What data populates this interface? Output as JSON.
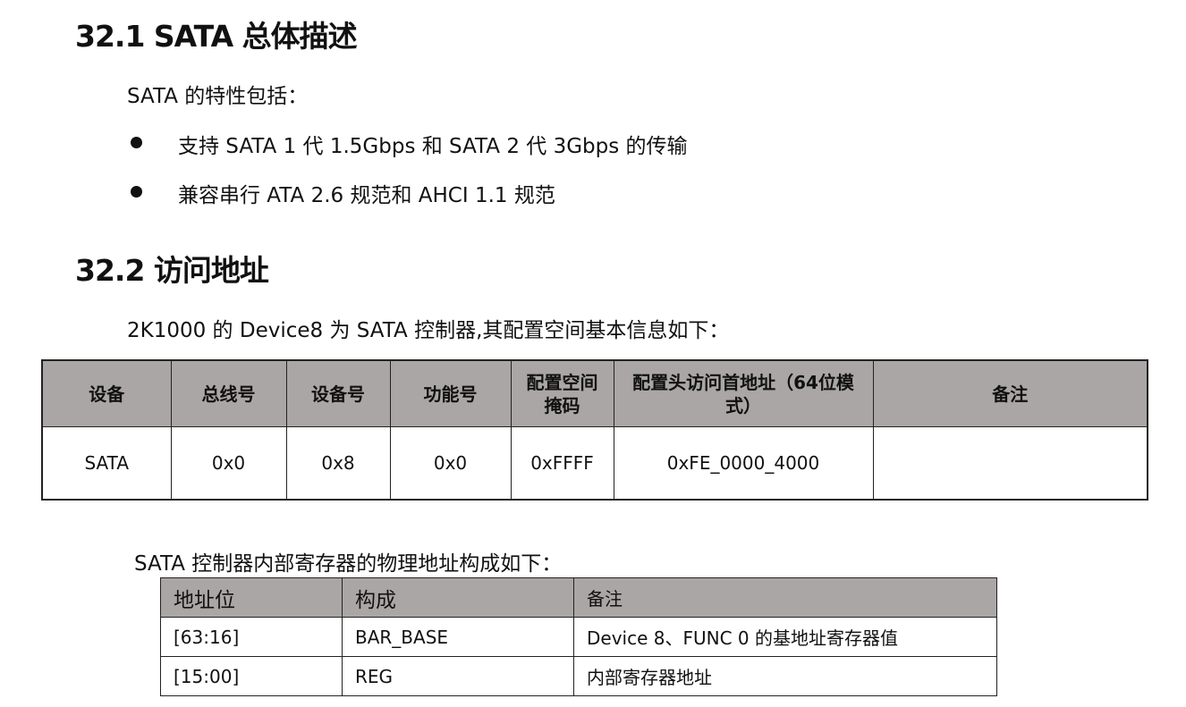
{
  "s1": {
    "title": "32.1 SATA 总体描述",
    "intro": "SATA 的特性包括：",
    "bullets": [
      "支持 SATA 1 代 1.5Gbps 和 SATA 2 代 3Gbps 的传输",
      "兼容串行 ATA 2.6 规范和 AHCI 1.1 规范"
    ]
  },
  "s2": {
    "title": "32.2 访问地址",
    "intro": "2K1000 的 Device8 为 SATA 控制器,其配置空间基本信息如下：",
    "table1": {
      "headers": [
        "设备",
        "总线号",
        "设备号",
        "功能号",
        "配置空间掩码",
        "配置头访问首地址（64位模式）",
        "备注"
      ],
      "row": [
        "SATA",
        "0x0",
        "0x8",
        "0x0",
        "0xFFFF",
        "0xFE_0000_4000",
        ""
      ]
    },
    "intro2": "SATA 控制器内部寄存器的物理地址构成如下：",
    "table2": {
      "headers": [
        "地址位",
        "构成",
        "备注"
      ],
      "rows": [
        [
          "[63:16]",
          "BAR_BASE",
          "Device 8、FUNC 0 的基地址寄存器值"
        ],
        [
          "[15:00]",
          "REG",
          "内部寄存器地址"
        ]
      ]
    }
  }
}
